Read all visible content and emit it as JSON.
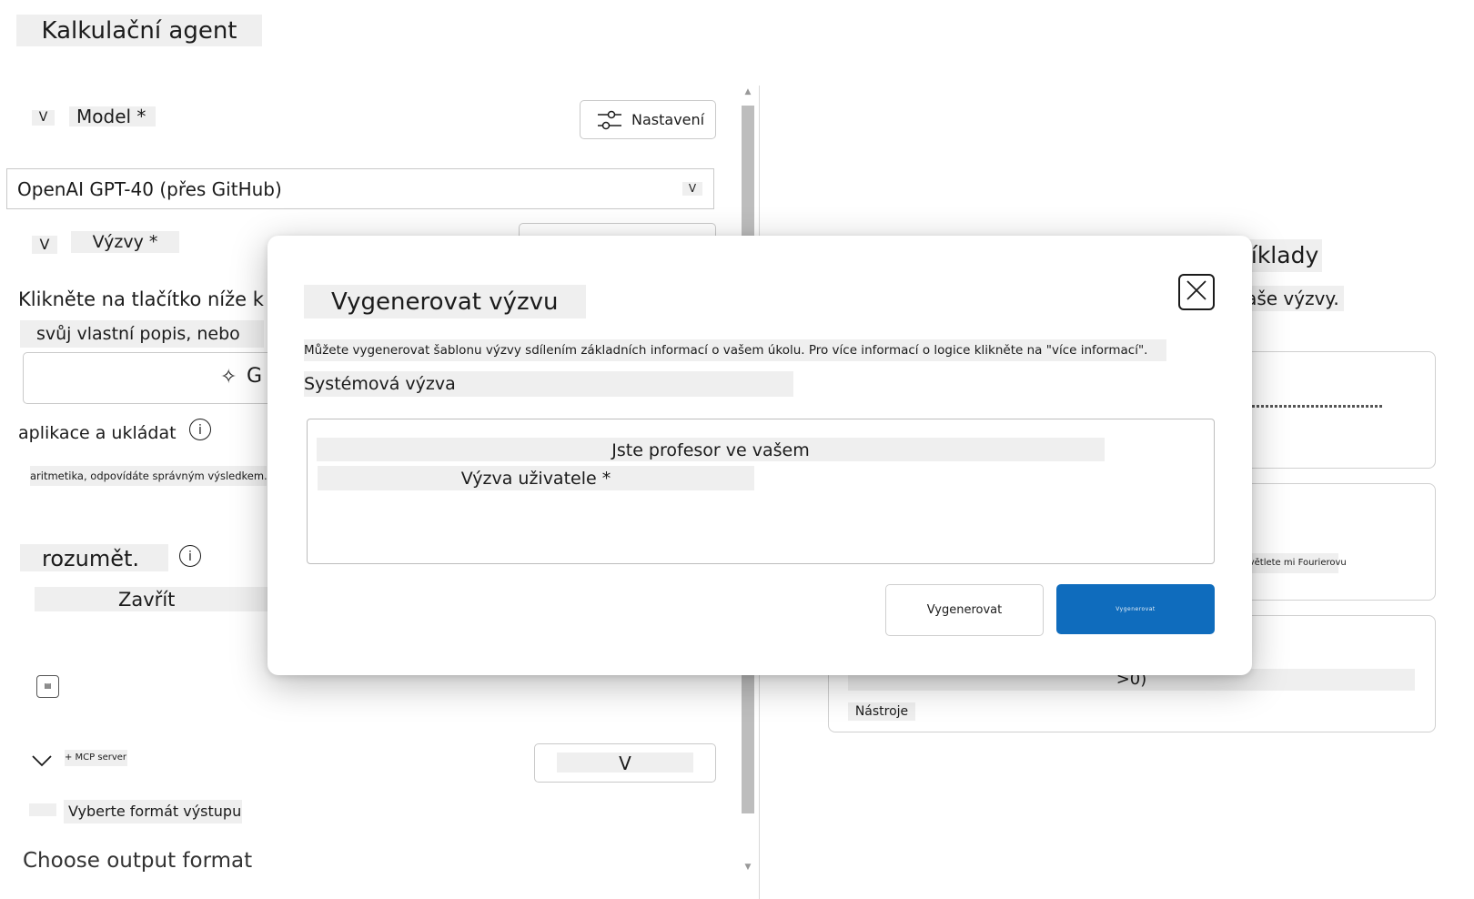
{
  "app": {
    "title": "Kalkulační agent"
  },
  "model_section": {
    "toggle": "V",
    "label": "Model *",
    "settings_button": "Nastavení",
    "selected_model": "OpenAI GPT-40 (přes GitHub)",
    "select_chevron": "V"
  },
  "prompts_section": {
    "toggle": "V",
    "label": "Výzvy *",
    "instruction_line1": "Klikněte na tlačítko níže k",
    "instruction_line2": "svůj vlastní popis, nebo",
    "generate_button_partial": "G",
    "storage_note": "aplikace a ukládat",
    "system_text": "aritmetika, odpovídáte správným výsledkem.",
    "understand_label": "rozumět.",
    "close_label": "Zavřít"
  },
  "tools_section": {
    "mcp_server": "+ MCP server",
    "dropdown_value": "V"
  },
  "output_section": {
    "label": "Vyberte formát výstupu",
    "placeholder": "Choose output format"
  },
  "right_panel": {
    "heading": "příklady",
    "subheading": "vaše výzvy.",
    "card2_text": "Vysvětlete mi Fourierovu",
    "card3_text": ">0)",
    "card3_tag": "Nástroje"
  },
  "modal": {
    "title": "Vygenerovat výzvu",
    "description": "Můžete vygenerovat šablonu výzvy sdílením základních informací o vašem úkolu. Pro více informací o logice klikněte na \"více informací\".",
    "system_label": "Systémová výzva",
    "textarea_line1": "Jste profesor ve vašem",
    "textarea_line2": "Výzva uživatele *",
    "generate_button": "Vygenerovat",
    "primary_button": "Vygenerovat"
  },
  "colors": {
    "primary": "#0f6cbd",
    "shade": "#efefef",
    "scroll_thumb": "#bdbdbd"
  }
}
